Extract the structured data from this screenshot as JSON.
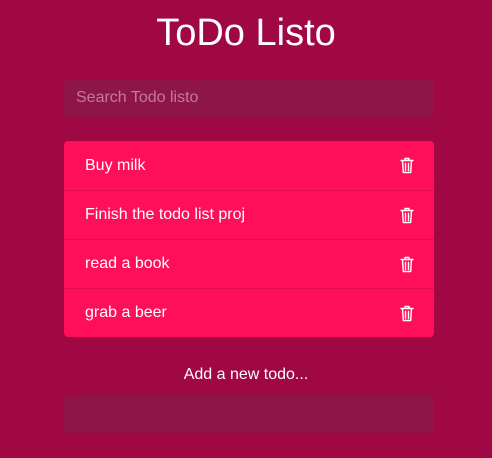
{
  "app": {
    "title": "ToDo Listo"
  },
  "search": {
    "placeholder": "Search Todo listo",
    "value": ""
  },
  "todos": [
    {
      "text": "Buy milk",
      "icon": "trash-icon"
    },
    {
      "text": "Finish the todo list proj",
      "icon": "trash-icon"
    },
    {
      "text": "read a book",
      "icon": "trash-icon"
    },
    {
      "text": "grab a beer",
      "icon": "trash-icon"
    }
  ],
  "add": {
    "label": "Add a new todo...",
    "value": ""
  },
  "colors": {
    "background": "#a00844",
    "input_background": "#8e1547",
    "list_background": "#ff0f59",
    "text": "#ffffff"
  }
}
